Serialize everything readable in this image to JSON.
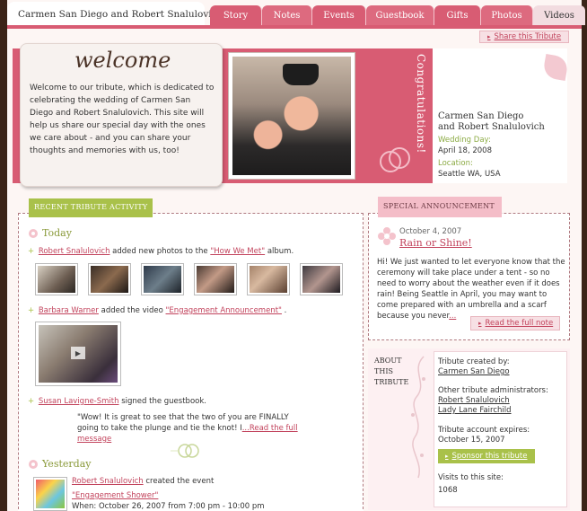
{
  "header": {
    "site_title": "Carmen San Diego and Robert Snalulovich",
    "tabs": [
      "Story",
      "Notes",
      "Events",
      "Guestbook",
      "Gifts",
      "Photos",
      "Videos"
    ],
    "share_label": "Share this Tribute"
  },
  "hero": {
    "welcome_title": "welcome",
    "welcome_text": "Welcome to our tribute, which is dedicated to celebrating the wedding of Carmen San Diego and Robert Snalulovich. This site will help us share our special day with the ones we care about - and you can share your thoughts and memories with us, too!",
    "congrats": "Congratulations!",
    "couple_line1": "Carmen San Diego",
    "couple_line2": "and Robert Snalulovich",
    "wedding_day_label": "Wedding Day:",
    "wedding_day_value": "April 18, 2008",
    "location_label": "Location:",
    "location_value": "Seattle WA, USA"
  },
  "activity": {
    "tab_label": "RECENT TRIBUTE ACTIVITY",
    "today_heading": "Today",
    "entry1": {
      "user": "Robert Snalulovich",
      "text": " added new photos to the ",
      "album": "\"How We Met\"",
      "suffix": " album."
    },
    "entry2": {
      "user": "Barbara Warner",
      "text": " added the video ",
      "video": "\"Engagement Announcement\"",
      "suffix": "."
    },
    "entry3": {
      "user": "Susan Lavigne-Smith",
      "text": " signed the guestbook."
    },
    "quote_text": "\"Wow! It is great to see that the two of you are FINALLY going to take the plunge and tie the knot! I",
    "quote_link": "...Read the full message",
    "yesterday_heading": "Yesterday",
    "entry4": {
      "user": "Robert Snalulovich",
      "text": " created the event",
      "event": "\"Engagement Shower\"",
      "when": "When: October 26, 2007 from 7:00 pm - 10:00 pm"
    }
  },
  "announcement": {
    "tab_label": "SPECIAL ANNOUNCEMENT",
    "date": "October 4, 2007",
    "title": "Rain or Shine!",
    "body": "Hi! We just wanted to let everyone know that the ceremony will take place under a tent - so no need to worry about the weather even if it does rain! Being Seattle in April, you may want to come prepared with an umbrella and a scarf because you never",
    "body_link": "...",
    "read_label": "Read the full note"
  },
  "about": {
    "label": "ABOUT THIS TRIBUTE",
    "created_by_label": "Tribute created by:",
    "created_by": "Carmen San Diego",
    "admins_label": "Other tribute administrators:",
    "admin1": "Robert Snalulovich",
    "admin2": "Lady Lane Fairchild",
    "expires_label": "Tribute account expires:",
    "expires_value": "October 15, 2007",
    "sponsor_label": "Sponsor this tribute",
    "visits_label": "Visits to this site:",
    "visits_value": "1068"
  },
  "colors": {
    "brand_pink": "#d85c73",
    "accent_green": "#a9c14a",
    "link_pink": "#c2435c"
  }
}
